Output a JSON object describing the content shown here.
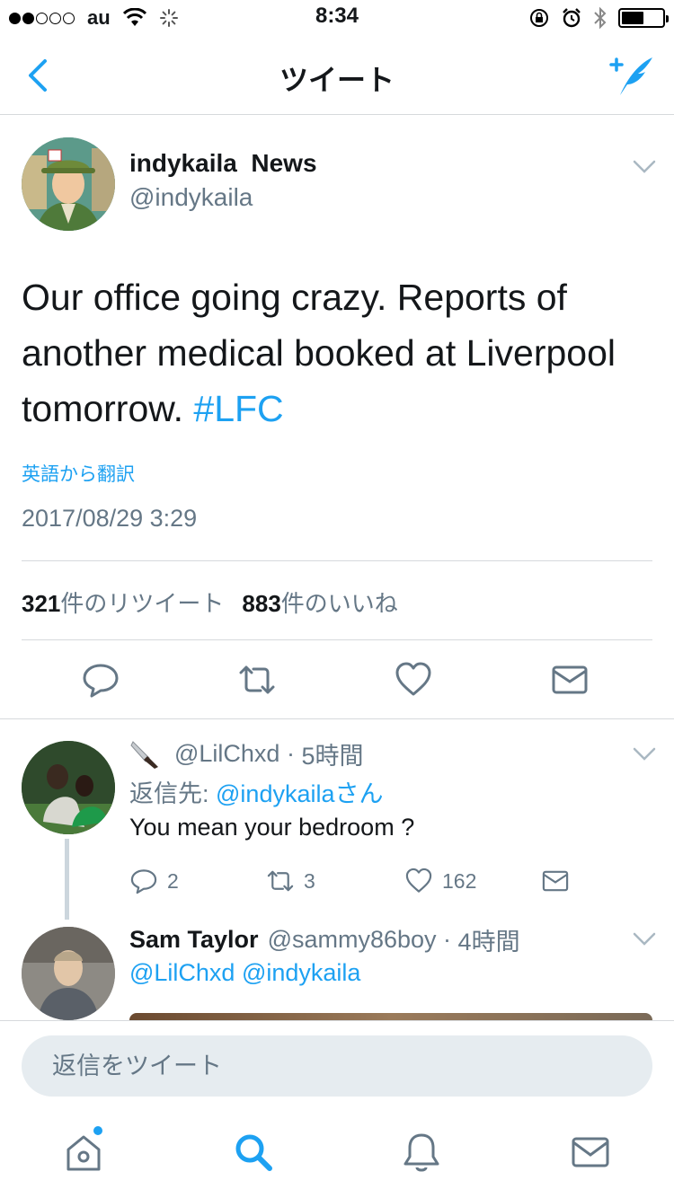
{
  "status_bar": {
    "carrier": "au",
    "time": "8:34"
  },
  "nav": {
    "title": "ツイート"
  },
  "tweet": {
    "author_name": "indykaila  News",
    "author_handle": "@indykaila",
    "text": "Our office going crazy. Reports of another medical booked at Liverpool tomorrow. ",
    "hashtag": "#LFC",
    "translate_label": "英語から翻訳",
    "timestamp": "2017/08/29 3:29",
    "retweet_count": "321",
    "retweet_label": "件のリツイート",
    "like_count": "883",
    "like_label": "件のいいね"
  },
  "replies": [
    {
      "handle": "@LilChxd",
      "time": "5時間",
      "reply_to_label": "返信先: ",
      "reply_to_mention": "@indykailaさん",
      "text": "You mean your bedroom ?",
      "reply_count": "2",
      "retweet_count": "3",
      "like_count": "162"
    },
    {
      "name": "Sam Taylor",
      "handle": "@sammy86boy",
      "time": "4時間",
      "mentions": "@LilChxd @indykaila"
    }
  ],
  "composer": {
    "placeholder": "返信をツイート"
  },
  "colors": {
    "accent": "#1da1f2",
    "secondary_text": "#657786",
    "divider": "#d6d9dc"
  }
}
